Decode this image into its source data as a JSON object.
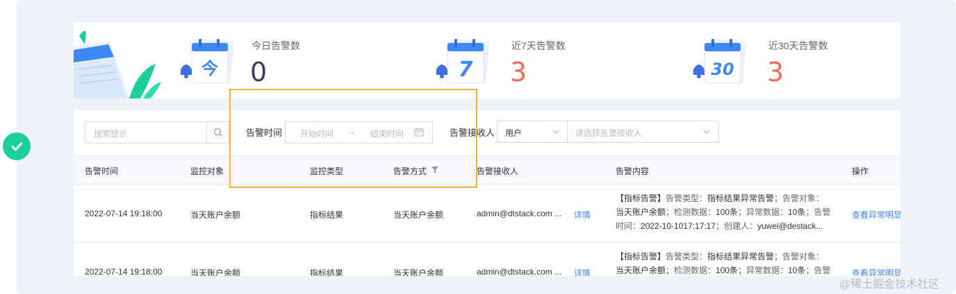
{
  "stats": [
    {
      "icon": "calendar-today-icon",
      "cal_text": "今",
      "label": "今日告警数",
      "value": "0",
      "color": "#3b3f5c"
    },
    {
      "icon": "calendar-7-icon",
      "cal_text": "7",
      "label": "近7天告警数",
      "value": "3",
      "color": "#ef6b5b"
    },
    {
      "icon": "calendar-30-icon",
      "cal_text": "30",
      "label": "近30天告警数",
      "value": "3",
      "color": "#ef6b5b"
    }
  ],
  "filters": {
    "search_placeholder": "搜索提示",
    "time_label": "告警时间",
    "start_placeholder": "开始时间",
    "arrow": "→",
    "end_placeholder": "结束时间",
    "receiver_label": "告警接收人",
    "receiver_type": "用户",
    "receiver_placeholder": "请选择告警接收人"
  },
  "table": {
    "headers": [
      "告警时间",
      "监控对象",
      "监控类型",
      "告警方式",
      "告警接收人",
      "告警内容",
      "操作"
    ],
    "rows": [
      {
        "time": "2022-07-14 19:18:00",
        "object": "当天账户余额",
        "type": "指标结果",
        "method": "当天账户余额",
        "receiver": "admin@dtstack.com ...",
        "detail": "详情",
        "content": {
          "l1a": "【指标告警】",
          "l1b": "告警类型：",
          "l1c": "指标结果异常告警",
          "l1d": "；告警对象：",
          "l2a": "当天账户余额",
          "l2b": "；检测数据：",
          "l2c": "100条",
          "l2d": "；异常数据：",
          "l2e": "10条",
          "l2f": "；告警",
          "l3a": "时间：",
          "l3b": "2022-10-1017:17:17",
          "l3c": "；创建人：",
          "l3d": "yuwei@destack..."
        },
        "action": "查看异常明显"
      },
      {
        "time": "2022-07-14 19:18:00",
        "object": "当天账户余额",
        "type": "指标结果",
        "method": "当天账户余额",
        "receiver": "admin@dtstack.com ...",
        "detail": "详情",
        "content": {
          "l1a": "【指标告警】",
          "l1b": "告警类型：",
          "l1c": "指标结果异常告警",
          "l1d": "；告警对象：",
          "l2a": "当天账户余额",
          "l2b": "；检测数据：",
          "l2c": "100条",
          "l2d": "；异常数据：",
          "l2e": "10条",
          "l2f": "；告警",
          "l3a": "",
          "l3b": "",
          "l3c": "",
          "l3d": ""
        },
        "action": "查看异常明显"
      }
    ]
  },
  "watermark": "@稀土掘金技术社区",
  "colors": {
    "accent": "#3f87f5",
    "danger": "#ef6b5b",
    "success": "#1ecf9b",
    "highlight": "#f4b032"
  }
}
